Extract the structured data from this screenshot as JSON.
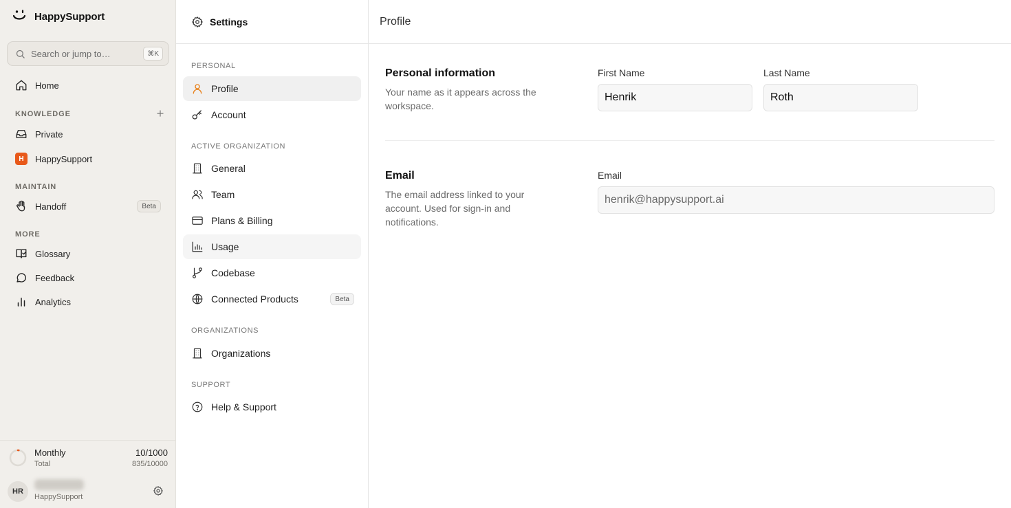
{
  "app": {
    "name": "HappySupport",
    "search_placeholder": "Search or jump to…",
    "search_shortcut": "⌘K"
  },
  "sidebar": {
    "home_label": "Home",
    "sections": {
      "knowledge": "KNOWLEDGE",
      "maintain": "MAINTAIN",
      "more": "MORE"
    },
    "knowledge_items": [
      {
        "label": "Private",
        "icon": "inbox-icon"
      },
      {
        "label": "HappySupport",
        "icon": "h-badge",
        "badge_letter": "H",
        "badge_color": "#e8591a"
      }
    ],
    "maintain_items": [
      {
        "label": "Handoff",
        "icon": "hand-icon",
        "badge": "Beta"
      }
    ],
    "more_items": [
      {
        "label": "Glossary",
        "icon": "book-check-icon"
      },
      {
        "label": "Feedback",
        "icon": "message-circle-icon"
      },
      {
        "label": "Analytics",
        "icon": "bar-chart-icon"
      }
    ],
    "usage": {
      "label": "Monthly",
      "sub_label": "Total",
      "count": "10/1000",
      "total": "835/10000",
      "fraction_used": 0.01,
      "accent_color": "#e8591a"
    },
    "user": {
      "initials": "HR",
      "org": "HappySupport"
    }
  },
  "settings_nav": {
    "title": "Settings",
    "sections": {
      "personal": "PERSONAL",
      "active_org": "ACTIVE ORGANIZATION",
      "organizations": "ORGANIZATIONS",
      "support": "SUPPORT"
    },
    "personal_items": [
      {
        "label": "Profile",
        "icon": "user-icon",
        "active": true
      },
      {
        "label": "Account",
        "icon": "key-icon"
      }
    ],
    "org_items": [
      {
        "label": "General",
        "icon": "building-icon"
      },
      {
        "label": "Team",
        "icon": "users-icon"
      },
      {
        "label": "Plans & Billing",
        "icon": "credit-card-icon"
      },
      {
        "label": "Usage",
        "icon": "chart-icon"
      },
      {
        "label": "Codebase",
        "icon": "git-branch-icon"
      },
      {
        "label": "Connected Products",
        "icon": "globe-icon",
        "badge": "Beta"
      }
    ],
    "organizations_items": [
      {
        "label": "Organizations",
        "icon": "building-icon"
      }
    ],
    "support_items": [
      {
        "label": "Help & Support",
        "icon": "help-circle-icon"
      }
    ]
  },
  "main": {
    "title": "Profile",
    "personal_info": {
      "title": "Personal information",
      "description": "Your name as it appears across the workspace.",
      "first_name_label": "First Name",
      "first_name_value": "Henrik",
      "last_name_label": "Last Name",
      "last_name_value": "Roth"
    },
    "email": {
      "title": "Email",
      "description": "The email address linked to your account. Used for sign-in and notifications.",
      "label": "Email",
      "value": "henrik@happysupport.ai"
    }
  }
}
